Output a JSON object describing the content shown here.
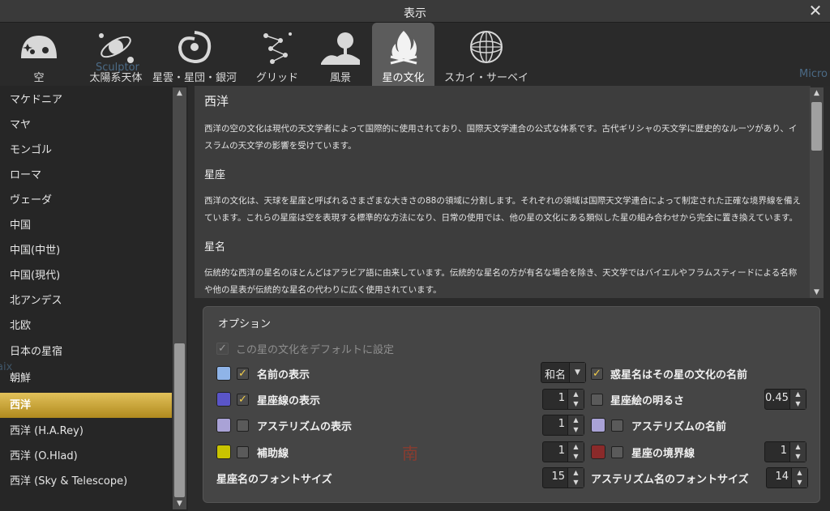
{
  "window": {
    "title": "表示",
    "close_glyph": "✕"
  },
  "tabs": [
    {
      "label": "空",
      "icon": "sky-icon"
    },
    {
      "label": "太陽系天体",
      "icon": "solar-system-icon"
    },
    {
      "label": "星雲・星団・銀河",
      "icon": "galaxy-icon"
    },
    {
      "label": "グリッド",
      "icon": "grid-icon"
    },
    {
      "label": "風景",
      "icon": "landscape-icon"
    },
    {
      "label": "星の文化",
      "icon": "campfire-icon"
    },
    {
      "label": "スカイ・サーベイ",
      "icon": "survey-sphere-icon"
    }
  ],
  "background_labels": {
    "sculptor": "Sculptor",
    "micro": "Micro",
    "aix": "aix",
    "south": "南"
  },
  "sidebar": {
    "items": [
      "マケドニア",
      "マヤ",
      "モンゴル",
      "ローマ",
      "ヴェーダ",
      "中国",
      "中国(中世)",
      "中国(現代)",
      "北アンデス",
      "北欧",
      "日本の星宿",
      "朝鮮",
      "西洋",
      "西洋 (H.A.Rey)",
      "西洋 (O.Hlad)",
      "西洋 (Sky & Telescope)"
    ],
    "selected": "西洋"
  },
  "description": {
    "title": "西洋",
    "p1": "西洋の空の文化は現代の天文学者によって国際的に使用されており、国際天文学連合の公式な体系です。古代ギリシャの天文学に歴史的なルーツがあり、イスラムの天文学の影響を受けています。",
    "h_constellations": "星座",
    "p2": "西洋の文化は、天球を星座と呼ばれるさまざまな大きさの88の領域に分割します。それぞれの領域は国際天文学連合によって制定された正確な境界線を備えています。これらの星座は空を表現する標準的な方法になり、日常の使用では、他の星の文化にある類似した星の組み合わせから完全に置き換えています。",
    "h_star_names": "星名",
    "p3": "伝統的な西洋の星名のほとんどはアラビア語に由来しています。伝統的な星名の方が有名な場合を除き、天文学ではバイエルやフラムスティードによる名称や他の星表が伝統的な星名の代わりに広く使用されています。"
  },
  "options": {
    "title": "オプション",
    "default_label": "この星の文化をデフォルトに設定",
    "show_names": "名前の表示",
    "name_style": "和名",
    "planet_names": "惑星名はその星の文化の名前",
    "show_lines": "星座線の表示",
    "lines_width": "1",
    "art_brightness_label": "星座絵の明るさ",
    "art_brightness": "0.45",
    "show_asterisms": "アステリズムの表示",
    "asterism_width": "1",
    "asterism_names": "アステリズムの名前",
    "ray_helpers": "補助線",
    "ray_width": "1",
    "boundaries": "星座の境界線",
    "boundary_width": "1",
    "font_size_label": "星座名のフォントサイズ",
    "font_size": "15",
    "asterism_font_label": "アステリズム名のフォントサイズ",
    "asterism_font": "14",
    "check_glyph": "✓",
    "arrow_up": "▲",
    "arrow_down": "▼"
  },
  "colors": {
    "names": "#8fb4e8",
    "lines": "#5a55c8",
    "asterisms": "#a9a2d6",
    "rays": "#c9c400",
    "boundaries": "#8a2a2a",
    "asterism_names": "#a9a2d6",
    "selected_item": "#c9a233"
  }
}
